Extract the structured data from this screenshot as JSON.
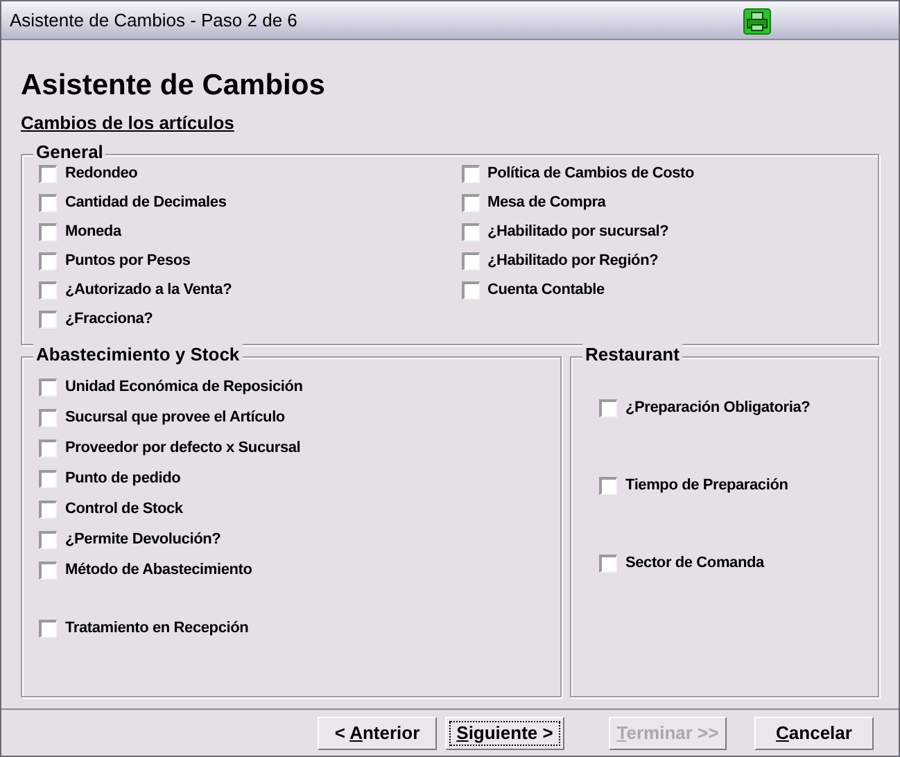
{
  "window": {
    "title": "Asistente de Cambios - Paso 2 de 6"
  },
  "heading": "Asistente de Cambios",
  "subheading": "Cambios de los artículos",
  "general": {
    "title": "General",
    "left": [
      {
        "label": "Redondeo",
        "checked": false
      },
      {
        "label": "Cantidad de Decimales",
        "checked": false
      },
      {
        "label": "Moneda",
        "checked": false
      },
      {
        "label": "Puntos por Pesos",
        "checked": false
      },
      {
        "label": "¿Autorizado a la Venta?",
        "checked": false
      },
      {
        "label": "¿Fracciona?",
        "checked": false
      }
    ],
    "right": [
      {
        "label": "Política de Cambios de Costo",
        "checked": false
      },
      {
        "label": "Mesa de Compra",
        "checked": false
      },
      {
        "label": "¿Habilitado por sucursal?",
        "checked": false
      },
      {
        "label": "¿Habilitado por Región?",
        "checked": false
      },
      {
        "label": "Cuenta Contable",
        "checked": false
      }
    ]
  },
  "stock": {
    "title": "Abastecimiento y Stock",
    "items": [
      {
        "label": "Unidad Económica de Reposición",
        "checked": false
      },
      {
        "label": "Sucursal que provee el Artículo",
        "checked": false
      },
      {
        "label": "Proveedor por defecto x Sucursal",
        "checked": false
      },
      {
        "label": "Punto de pedido",
        "checked": false
      },
      {
        "label": "Control de Stock",
        "checked": false
      },
      {
        "label": "¿Permite Devolución?",
        "checked": false
      },
      {
        "label": "Método de Abastecimiento",
        "checked": false
      },
      {
        "label": "Tratamiento en Recepción",
        "checked": false
      }
    ]
  },
  "restaurant": {
    "title": "Restaurant",
    "items": [
      {
        "label": "¿Preparación Obligatoria?",
        "checked": false
      },
      {
        "label": "Tiempo de Preparación",
        "checked": false
      },
      {
        "label": "Sector de Comanda",
        "checked": false
      }
    ]
  },
  "buttons": [
    {
      "before": "< ",
      "key": "A",
      "after": "nterior",
      "disabled": false,
      "focused": false
    },
    {
      "key": "S",
      "after": "iguiente >",
      "disabled": false,
      "focused": true
    },
    {
      "key": "T",
      "after": "erminar >>",
      "disabled": true,
      "focused": false
    },
    {
      "key": "C",
      "after": "ancelar",
      "disabled": false,
      "focused": false
    }
  ]
}
